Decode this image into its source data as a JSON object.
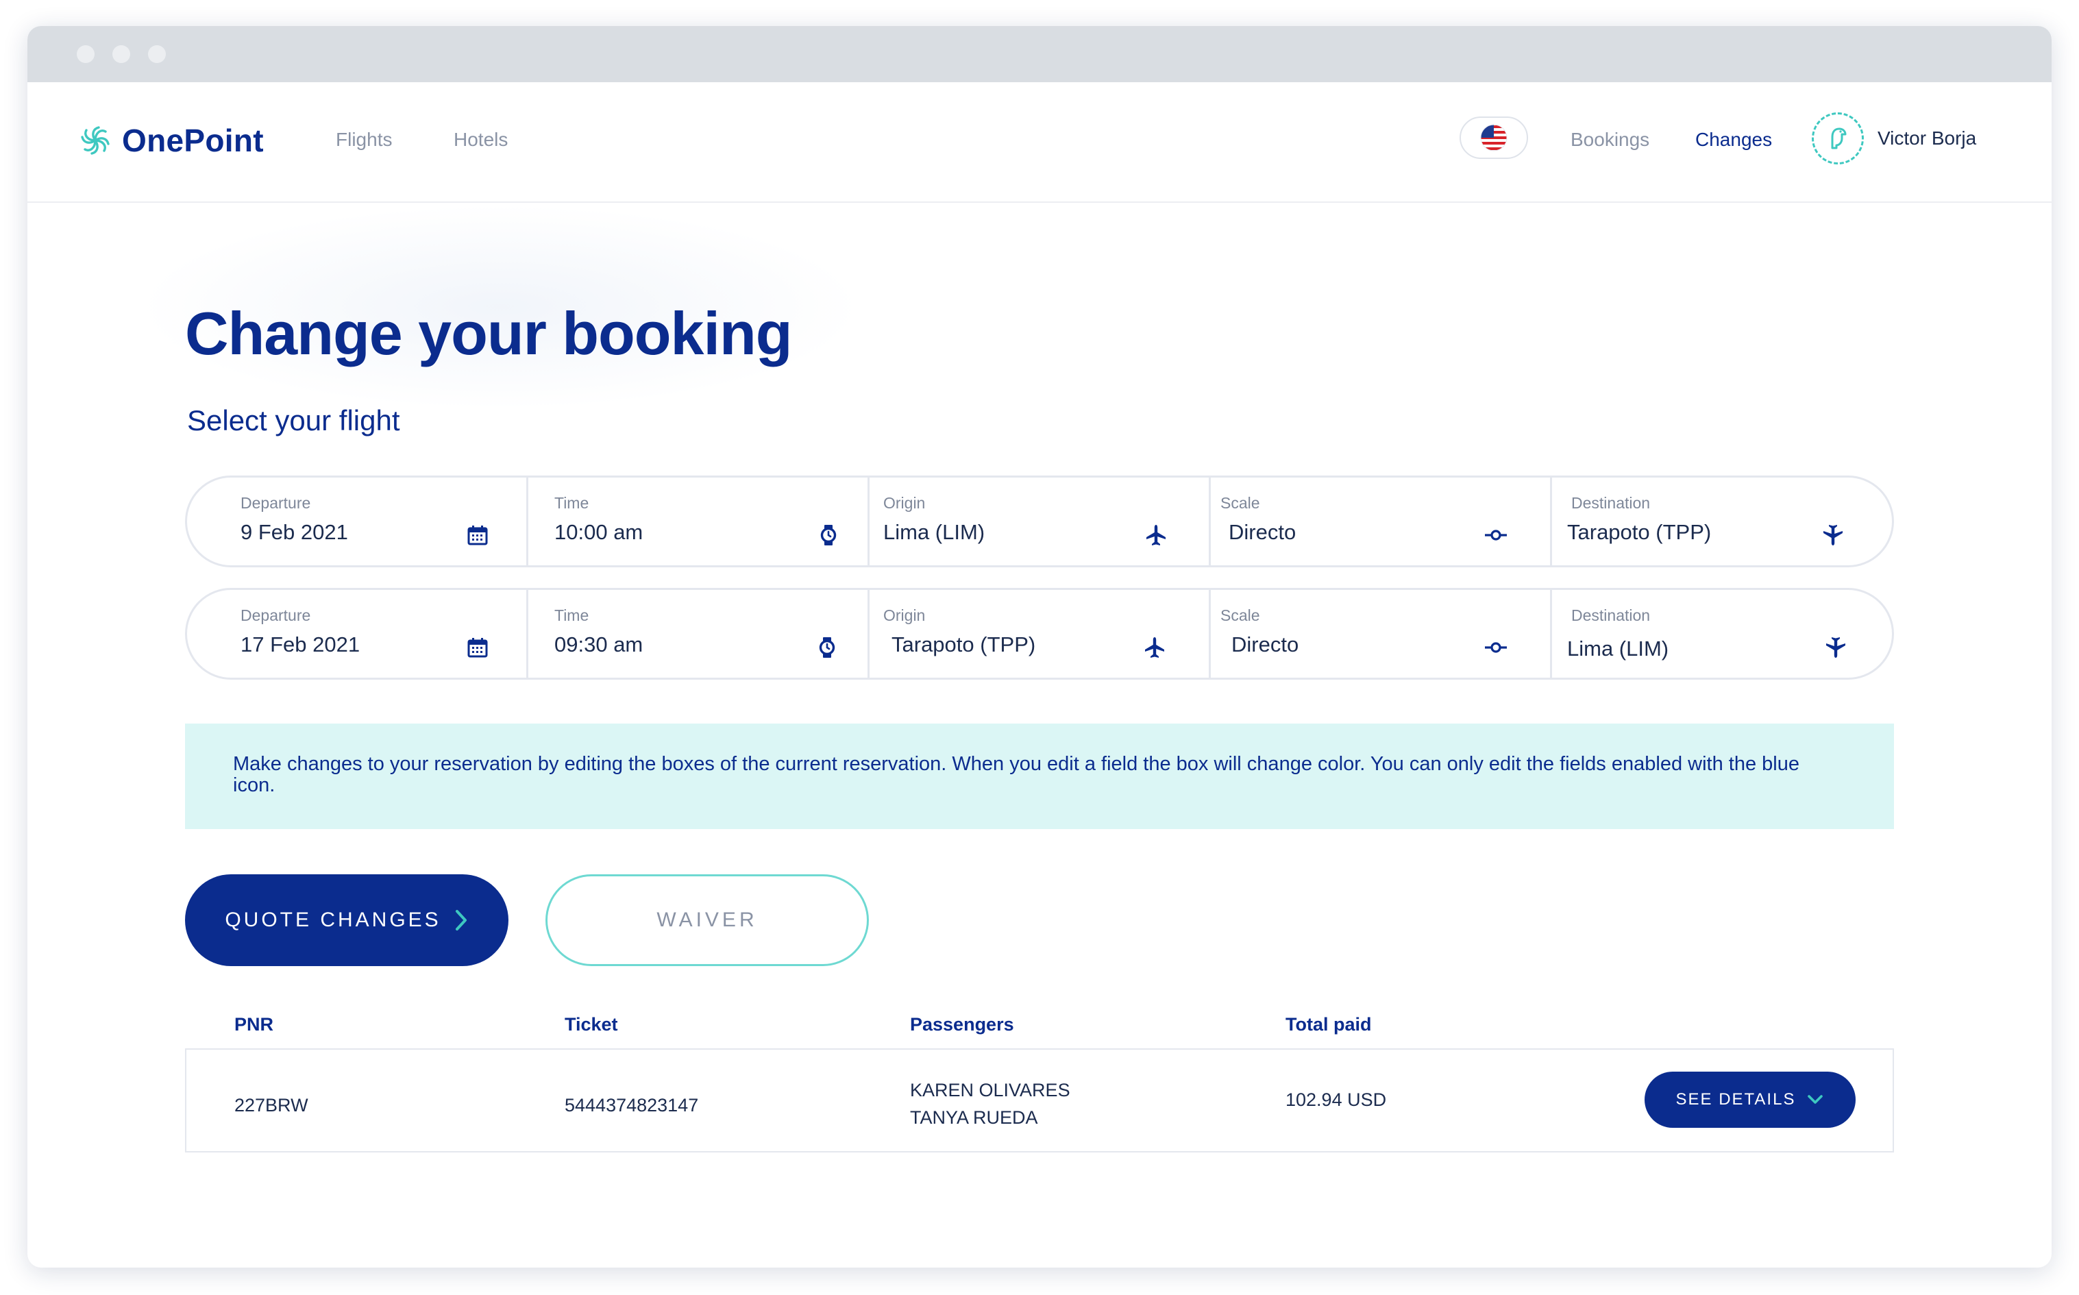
{
  "brand": {
    "name": "OnePoint",
    "accent": "#3ec8c0",
    "primary": "#0b2c8e"
  },
  "nav": {
    "left": [
      {
        "label": "Flights"
      },
      {
        "label": "Hotels"
      }
    ],
    "right": [
      {
        "label": "Bookings"
      },
      {
        "label": "Changes",
        "active": true
      }
    ],
    "flag_icon": "us-flag-icon",
    "user_name": "Victor Borja"
  },
  "page": {
    "title": "Change your booking",
    "subtitle": "Select your flight"
  },
  "flights": [
    {
      "departure": {
        "label": "Departure",
        "value": "9 Feb 2021",
        "icon": "calendar-icon"
      },
      "time": {
        "label": "Time",
        "value": "10:00 am",
        "icon": "watch-icon"
      },
      "origin": {
        "label": "Origin",
        "value": "Lima (LIM)",
        "icon": "plane-icon"
      },
      "scale": {
        "label": "Scale",
        "value": "Directo",
        "icon": "stop-icon"
      },
      "destination": {
        "label": "Destination",
        "value": "Tarapoto (TPP)",
        "icon": "plane-landing-icon"
      }
    },
    {
      "departure": {
        "label": "Departure",
        "value": "17 Feb 2021",
        "icon": "calendar-icon"
      },
      "time": {
        "label": "Time",
        "value": "09:30 am",
        "icon": "watch-icon"
      },
      "origin": {
        "label": "Origin",
        "value": "Tarapoto (TPP)",
        "icon": "plane-icon"
      },
      "scale": {
        "label": "Scale",
        "value": "Directo",
        "icon": "stop-icon"
      },
      "destination": {
        "label": "Destination",
        "value": "Lima (LIM)",
        "icon": "plane-landing-icon"
      }
    }
  ],
  "info_message": "Make changes to your reservation by editing the boxes of the current reservation. When you edit a field the box will change color. You can only edit the fields enabled with the blue icon.",
  "actions": {
    "quote_label": "QUOTE CHANGES",
    "waiver_label": "WAIVER"
  },
  "table": {
    "headers": [
      "PNR",
      "Ticket",
      "Passengers",
      "Total paid"
    ],
    "rows": [
      {
        "pnr": "227BRW",
        "ticket": "5444374823147",
        "passengers": [
          "KAREN OLIVARES",
          "TANYA RUEDA"
        ],
        "total": "102.94 USD",
        "details_label": "SEE DETAILS"
      }
    ]
  }
}
